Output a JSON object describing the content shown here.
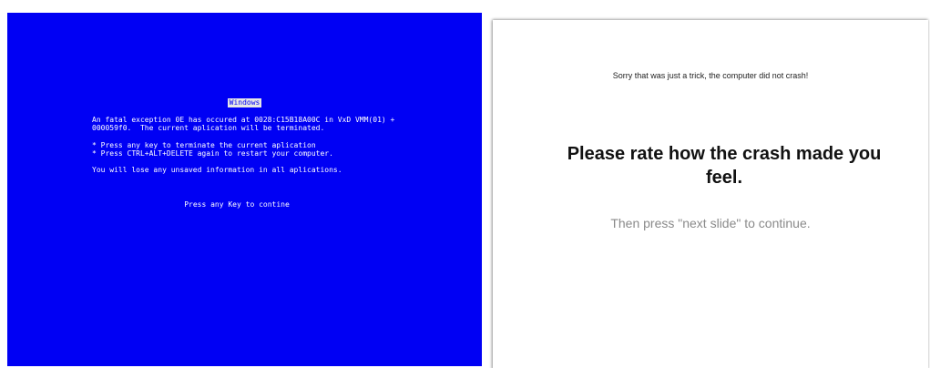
{
  "bsod": {
    "background_color": "#0000f4",
    "title": "Windows",
    "paragraph1": "An fatal exception 0E has occured at 0028:C15B18A00C in VxD VMM(01) +\n000059f0.  The current aplication will be terminated.",
    "paragraph2": "* Press any key to terminate the current aplication\n* Press CTRL+ALT+DELETE again to restart your computer.",
    "paragraph3": "You will lose any unsaved information in all aplications.",
    "continue_prompt": "Press any Key to contine"
  },
  "slide": {
    "trick_message": "Sorry that was just a trick, the computer did not crash!",
    "heading": "Please rate how the crash made you feel.",
    "instruction": "Then press \"next slide\" to continue."
  }
}
